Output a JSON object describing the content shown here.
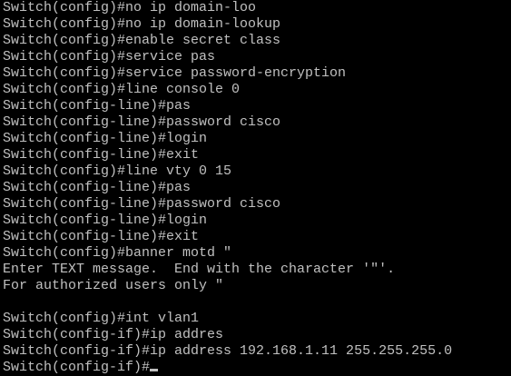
{
  "terminal": {
    "foreground_color": "#c0c0c0",
    "background_color": "#000000",
    "lines": [
      "Switch(config)#no ip domain-loo",
      "Switch(config)#no ip domain-lookup",
      "Switch(config)#enable secret class",
      "Switch(config)#service pas",
      "Switch(config)#service password-encryption",
      "Switch(config)#line console 0",
      "Switch(config-line)#pas",
      "Switch(config-line)#password cisco",
      "Switch(config-line)#login",
      "Switch(config-line)#exit",
      "Switch(config)#line vty 0 15",
      "Switch(config-line)#pas",
      "Switch(config-line)#password cisco",
      "Switch(config-line)#login",
      "Switch(config-line)#exit",
      "Switch(config)#banner motd \"",
      "Enter TEXT message.  End with the character '\"'.",
      "For authorized users only \"",
      "",
      "Switch(config)#int vlan1",
      "Switch(config-if)#ip addres",
      "Switch(config-if)#ip address 192.168.1.11 255.255.255.0"
    ],
    "prompt_line": "Switch(config-if)#"
  }
}
